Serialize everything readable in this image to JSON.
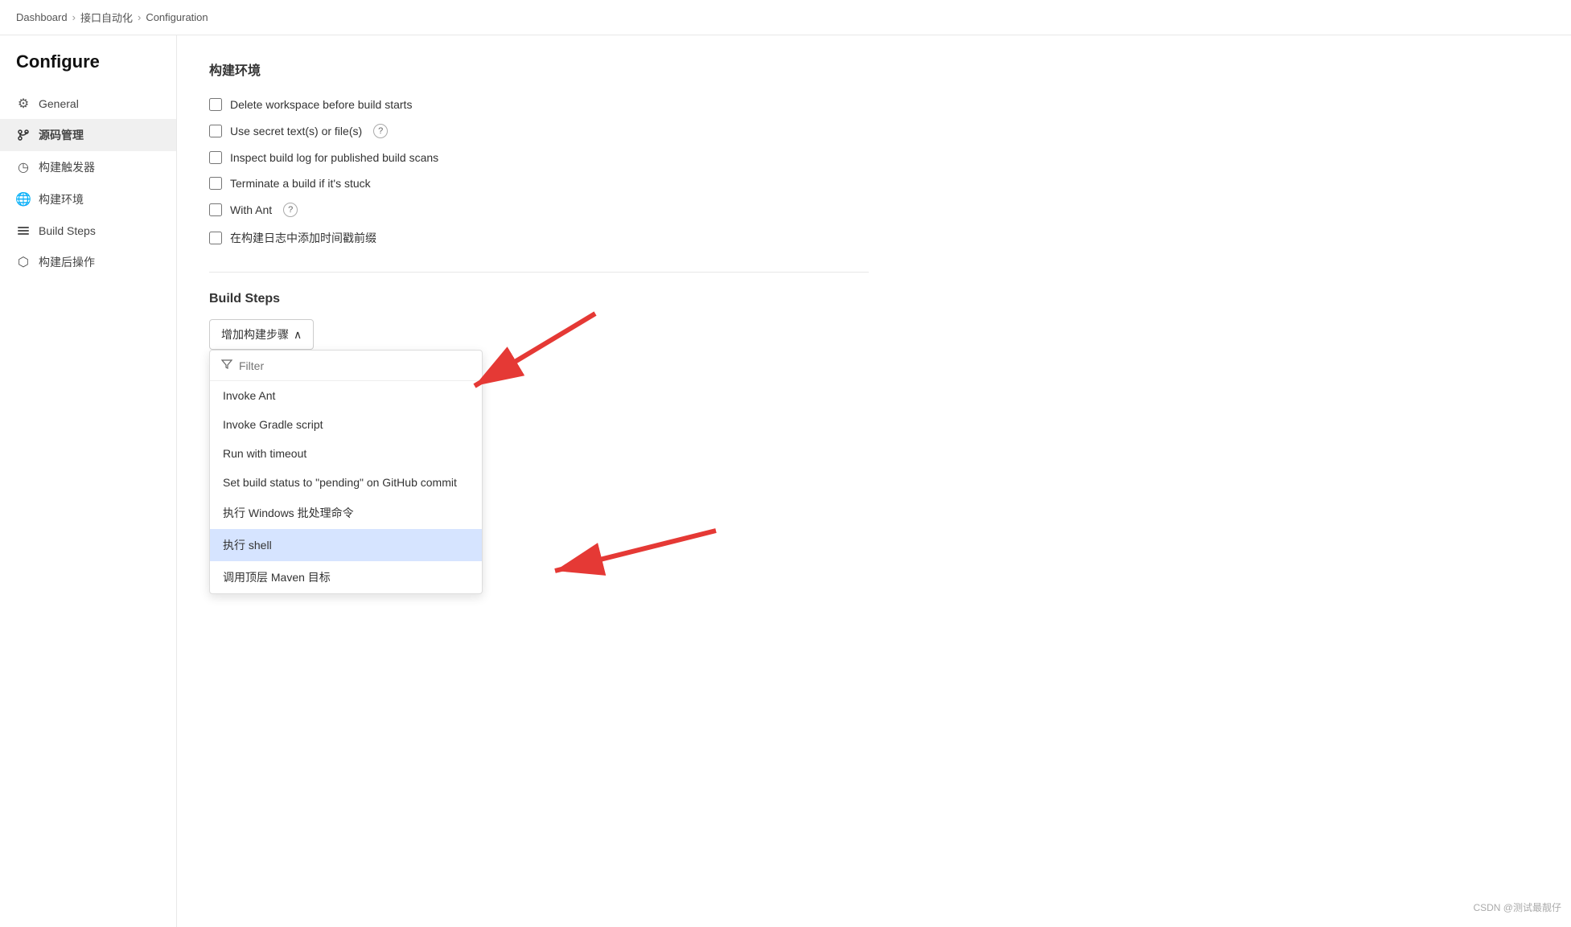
{
  "breadcrumb": {
    "items": [
      "Dashboard",
      "接口自动化",
      "Configuration"
    ],
    "separators": [
      ">",
      ">"
    ]
  },
  "sidebar": {
    "title": "Configure",
    "items": [
      {
        "id": "general",
        "label": "General",
        "icon": "gear"
      },
      {
        "id": "source",
        "label": "源码管理",
        "icon": "branch",
        "active": true
      },
      {
        "id": "trigger",
        "label": "构建触发器",
        "icon": "clock"
      },
      {
        "id": "env",
        "label": "构建环境",
        "icon": "globe"
      },
      {
        "id": "buildsteps",
        "label": "Build Steps",
        "icon": "list"
      },
      {
        "id": "post",
        "label": "构建后操作",
        "icon": "cube"
      }
    ]
  },
  "build_env_section": {
    "title": "构建环境",
    "checkboxes": [
      {
        "id": "delete-workspace",
        "label": "Delete workspace before build starts",
        "checked": false
      },
      {
        "id": "use-secret",
        "label": "Use secret text(s) or file(s)",
        "checked": false,
        "help": true
      },
      {
        "id": "inspect-log",
        "label": "Inspect build log for published build scans",
        "checked": false
      },
      {
        "id": "terminate-stuck",
        "label": "Terminate a build if it's stuck",
        "checked": false
      },
      {
        "id": "with-ant",
        "label": "With Ant",
        "checked": false,
        "help": true
      },
      {
        "id": "timestamp",
        "label": "在构建日志中添加时间戳前缀",
        "checked": false
      }
    ]
  },
  "build_steps_section": {
    "title": "Build Steps",
    "add_button_label": "增加构建步骤",
    "dropdown": {
      "filter_placeholder": "Filter",
      "items": [
        {
          "id": "invoke-ant",
          "label": "Invoke Ant"
        },
        {
          "id": "invoke-gradle",
          "label": "Invoke Gradle script"
        },
        {
          "id": "run-timeout",
          "label": "Run with timeout"
        },
        {
          "id": "set-build-status",
          "label": "Set build status to \"pending\" on GitHub commit"
        },
        {
          "id": "exec-windows",
          "label": "执行 Windows 批处理命令"
        },
        {
          "id": "exec-shell",
          "label": "执行 shell",
          "highlighted": true
        },
        {
          "id": "invoke-maven",
          "label": "调用顶层 Maven 目标"
        }
      ]
    }
  },
  "watermark": "CSDN @测试最靓仔"
}
